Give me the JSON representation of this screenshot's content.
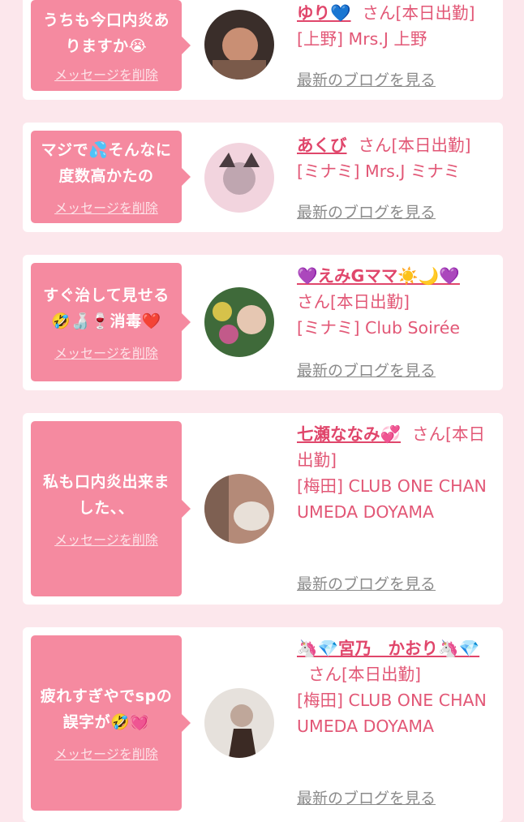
{
  "entries": [
    {
      "message": "うちも今口内炎ありますか😭",
      "delete_label": "メッセージを削除",
      "name": "ゆり💙",
      "suffix": "さん[本日出勤]",
      "shop": "[上野] Mrs.J 上野",
      "blog_label": "最新のブログを見る",
      "avatar_colors": [
        "#3a2e2a",
        "#c98f74",
        "#7a5a4a"
      ]
    },
    {
      "message": "マジで💦そんなに度数高かたの",
      "delete_label": "メッセージを削除",
      "name": "あくび",
      "suffix": "さん[本日出勤]",
      "shop": "[ミナミ] Mrs.J ミナミ",
      "blog_label": "最新のブログを見る",
      "avatar_colors": [
        "#f2d4de",
        "#bfa6b0",
        "#4a3c40"
      ]
    },
    {
      "message": "すぐ治して見せる🤣🍶🍷消毒❤️",
      "delete_label": "メッセージを削除",
      "name": "💜えみGママ☀️🌙💜",
      "suffix": "さん[本日出勤]",
      "shop": "[ミナミ] Club Soirée",
      "blog_label": "最新のブログを見る",
      "avatar_colors": [
        "#d6c24a",
        "#c25a8a",
        "#3f6a3a"
      ]
    },
    {
      "message": "私も口内炎出来ました、、",
      "delete_label": "メッセージを削除",
      "name": "七瀬ななみ💞",
      "suffix": "さん[本日出勤]",
      "shop": "[梅田] CLUB ONE CHAN UMEDA DOYAMA",
      "blog_label": "最新のブログを見る",
      "avatar_colors": [
        "#b48a78",
        "#e8e0d8",
        "#5a4438"
      ]
    },
    {
      "message": "疲れすぎやでspの誤字が🤣💓",
      "delete_label": "メッセージを削除",
      "name": "🦄💎宮乃　かおり🦄💎",
      "suffix": "さん[本日出勤]",
      "shop": "[梅田] CLUB ONE CHAN UMEDA DOYAMA",
      "blog_label": "最新のブログを見る",
      "avatar_colors": [
        "#e6e1dc",
        "#3b2a24",
        "#bfa79a"
      ]
    }
  ]
}
